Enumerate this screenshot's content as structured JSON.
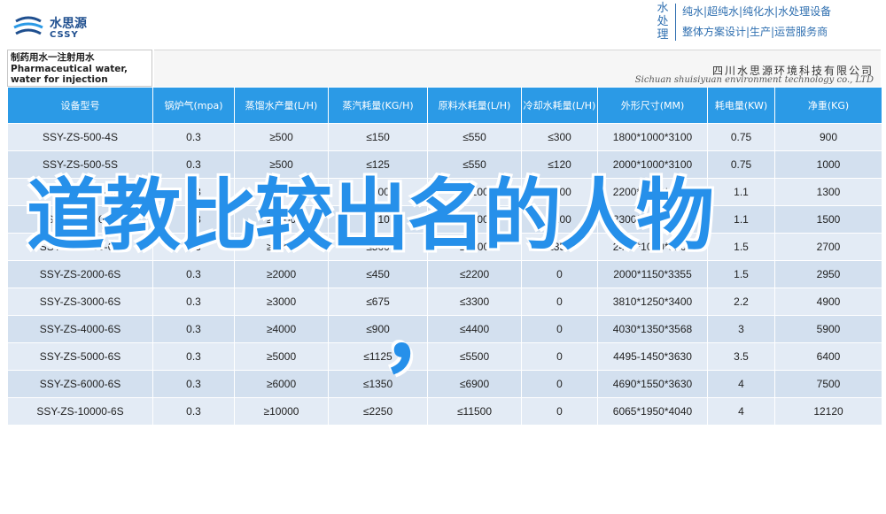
{
  "brand": {
    "name_cn": "水思源",
    "name_en": "CSSY",
    "color": "#1f4f8f"
  },
  "tagline": {
    "vertical": "水处理",
    "line1": "纯水|超纯水|纯化水|水处理设备",
    "line2": "整体方案设计|生产|运营服务商"
  },
  "document": {
    "title_cn": "制药用水一注射用水",
    "title_en": "Pharmaceutical water, water for injection"
  },
  "company": {
    "name_cn": "四川水思源环境科技有限公司",
    "name_en": "Sichuan shuisiyuan environment technology co., LTD"
  },
  "table": {
    "headers": [
      "设备型号",
      "锅炉气(mpa)",
      "蒸馏水产量(L/H)",
      "蒸汽耗量(KG/H)",
      "原料水耗量(L/H)",
      "冷却水耗量(L/H)",
      "外形尺寸(MM)",
      "耗电量(KW)",
      "净重(KG)"
    ],
    "rows": [
      [
        "SSY-ZS-500-4S",
        "0.3",
        "≥500",
        "≤150",
        "≤550",
        "≤300",
        "1800*1000*3100",
        "0.75",
        "900"
      ],
      [
        "SSY-ZS-500-5S",
        "0.3",
        "≥500",
        "≤125",
        "≤550",
        "≤120",
        "2000*1000*3100",
        "0.75",
        "1000"
      ],
      [
        "SSY-ZS-1000-4S",
        "0.3",
        "≥1000",
        "≤300",
        "≤1100",
        "≤600",
        "2200*1000*3100",
        "1.1",
        "1300"
      ],
      [
        "SSY-ZS-1000-6S",
        "0.3",
        "≥1000",
        "≤210",
        "≤1100",
        "≤200",
        "2300*1000*3100",
        "1.1",
        "1500"
      ],
      [
        "SSY-ZS-1500-6S",
        "0.3",
        "≥2000",
        "≤500",
        "≤2200",
        "≤350",
        "2450*1000*3100",
        "1.5",
        "2700"
      ],
      [
        "SSY-ZS-2000-6S",
        "0.3",
        "≥2000",
        "≤450",
        "≤2200",
        "0",
        "2000*1150*3355",
        "1.5",
        "2950"
      ],
      [
        "SSY-ZS-3000-6S",
        "0.3",
        "≥3000",
        "≤675",
        "≤3300",
        "0",
        "3810*1250*3400",
        "2.2",
        "4900"
      ],
      [
        "SSY-ZS-4000-6S",
        "0.3",
        "≥4000",
        "≤900",
        "≤4400",
        "0",
        "4030*1350*3568",
        "3",
        "5900"
      ],
      [
        "SSY-ZS-5000-6S",
        "0.3",
        "≥5000",
        "≤1125",
        "≤5500",
        "0",
        "4495-1450*3630",
        "3.5",
        "6400"
      ],
      [
        "SSY-ZS-6000-6S",
        "0.3",
        "≥6000",
        "≤1350",
        "≤6900",
        "0",
        "4690*1550*3630",
        "4",
        "7500"
      ],
      [
        "SSY-ZS-10000-6S",
        "0.3",
        "≥10000",
        "≤2250",
        "≤11500",
        "0",
        "6065*1950*4040",
        "4",
        "12120"
      ]
    ]
  },
  "overlay": {
    "text": "道教比较出名的人物",
    "punctuation": "，",
    "color": "#2690ea"
  },
  "colors": {
    "header_bg": "#2b9ae6",
    "row_odd": "#e3ebf5",
    "row_even": "#d3e0ef"
  }
}
